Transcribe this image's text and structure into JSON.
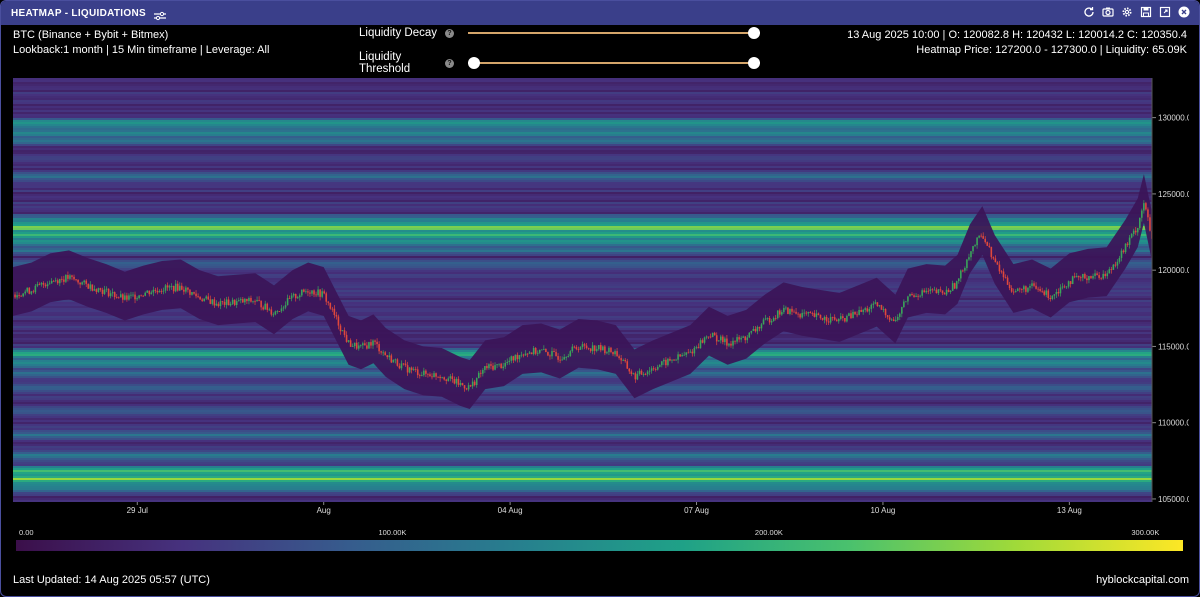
{
  "window": {
    "title": "HEATMAP - LIQUIDATIONS",
    "icons": [
      "tune-icon",
      "refresh-icon",
      "camera-icon",
      "gear-icon",
      "save-icon",
      "expand-icon",
      "close-icon"
    ]
  },
  "info": {
    "line1": "BTC (Binance + Bybit + Bitmex)",
    "line2": "Lookback:1 month | 15 Min timeframe | Leverage: All"
  },
  "ohlc": {
    "line1": "13 Aug 2025 10:00 | O: 120082.8 H: 120432 L: 120014.2 C: 120350.4",
    "line2": "Heatmap Price: 127200.0 - 127300.0 | Liquidity: 65.09K"
  },
  "controls": {
    "decay_label": "Liquidity Decay",
    "threshold_label": "Liquidity Threshold",
    "decay_value": 1.0,
    "threshold_min": 0.0,
    "threshold_max": 1.0
  },
  "footer": {
    "updated": "Last Updated: 14 Aug 2025 05:57 (UTC)",
    "brand": "hyblockcapital.com"
  },
  "colors": {
    "window_border": "#4a4f9e",
    "titlebar": "#3a3f8a",
    "up_candle": "#3aa55a",
    "down_candle": "#e0483c",
    "slider": "#d4a56a",
    "colormap": [
      "#3b0f4a",
      "#46327e",
      "#365c8d",
      "#277f8e",
      "#1fa187",
      "#4ac16d",
      "#a0da39",
      "#fde725"
    ]
  },
  "chart_data": {
    "type": "heatmap",
    "title": "",
    "y_ticks": [
      "130000.0",
      "125000.0",
      "120000.0",
      "115000.0",
      "110000.0",
      "105000.0"
    ],
    "ylim": [
      104800,
      132600
    ],
    "x_ticks": [
      {
        "label": "29 Jul",
        "t": 4
      },
      {
        "label": "Aug",
        "t": 7
      },
      {
        "label": "04 Aug",
        "t": 10
      },
      {
        "label": "07 Aug",
        "t": 13
      },
      {
        "label": "10 Aug",
        "t": 16
      },
      {
        "label": "13 Aug",
        "t": 19
      }
    ],
    "xlim": [
      2,
      20.33
    ],
    "colorbar": {
      "ticks": [
        "0.00",
        "100.00K",
        "200.00K",
        "300.00K"
      ],
      "values": [
        0,
        100000,
        200000,
        300000
      ],
      "max": 310000
    },
    "liquidity_bands": [
      {
        "price": 129600,
        "value": 185000
      },
      {
        "price": 129000,
        "value": 160000
      },
      {
        "price": 128500,
        "value": 130000
      },
      {
        "price": 127300,
        "value": 65090
      },
      {
        "price": 126100,
        "value": 120000
      },
      {
        "price": 123300,
        "value": 150000
      },
      {
        "price": 122800,
        "value": 270000
      },
      {
        "price": 122300,
        "value": 235000
      },
      {
        "price": 121900,
        "value": 175000
      },
      {
        "price": 121300,
        "value": 125000
      },
      {
        "price": 120400,
        "value": 110000
      },
      {
        "price": 114500,
        "value": 200000
      },
      {
        "price": 113900,
        "value": 175000
      },
      {
        "price": 113200,
        "value": 120000
      },
      {
        "price": 112300,
        "value": 110000
      },
      {
        "price": 110800,
        "value": 100000
      },
      {
        "price": 109200,
        "value": 120000
      },
      {
        "price": 107800,
        "value": 140000
      },
      {
        "price": 106800,
        "value": 240000
      },
      {
        "price": 106300,
        "value": 280000
      },
      {
        "price": 105800,
        "value": 160000
      }
    ],
    "price_path": [
      {
        "t": 2.0,
        "p": 118400
      },
      {
        "t": 2.3,
        "p": 118700
      },
      {
        "t": 2.6,
        "p": 119300
      },
      {
        "t": 2.9,
        "p": 119500
      },
      {
        "t": 3.2,
        "p": 119000
      },
      {
        "t": 3.5,
        "p": 118600
      },
      {
        "t": 3.8,
        "p": 118100
      },
      {
        "t": 4.1,
        "p": 118500
      },
      {
        "t": 4.4,
        "p": 118800
      },
      {
        "t": 4.7,
        "p": 118900
      },
      {
        "t": 5.0,
        "p": 118200
      },
      {
        "t": 5.3,
        "p": 117800
      },
      {
        "t": 5.6,
        "p": 117900
      },
      {
        "t": 5.9,
        "p": 118000
      },
      {
        "t": 6.2,
        "p": 117200
      },
      {
        "t": 6.5,
        "p": 118200
      },
      {
        "t": 6.75,
        "p": 118700
      },
      {
        "t": 7.0,
        "p": 118400
      },
      {
        "t": 7.2,
        "p": 116800
      },
      {
        "t": 7.4,
        "p": 115200
      },
      {
        "t": 7.6,
        "p": 114900
      },
      {
        "t": 7.8,
        "p": 115300
      },
      {
        "t": 8.0,
        "p": 114400
      },
      {
        "t": 8.3,
        "p": 113600
      },
      {
        "t": 8.6,
        "p": 113200
      },
      {
        "t": 8.9,
        "p": 113100
      },
      {
        "t": 9.2,
        "p": 112500
      },
      {
        "t": 9.35,
        "p": 112300
      },
      {
        "t": 9.6,
        "p": 113600
      },
      {
        "t": 9.9,
        "p": 113800
      },
      {
        "t": 10.2,
        "p": 114600
      },
      {
        "t": 10.5,
        "p": 114700
      },
      {
        "t": 10.8,
        "p": 114300
      },
      {
        "t": 11.1,
        "p": 115000
      },
      {
        "t": 11.4,
        "p": 114900
      },
      {
        "t": 11.7,
        "p": 114600
      },
      {
        "t": 12.0,
        "p": 113000
      },
      {
        "t": 12.3,
        "p": 113600
      },
      {
        "t": 12.6,
        "p": 114100
      },
      {
        "t": 12.9,
        "p": 114600
      },
      {
        "t": 13.2,
        "p": 115800
      },
      {
        "t": 13.5,
        "p": 115200
      },
      {
        "t": 13.8,
        "p": 115600
      },
      {
        "t": 14.1,
        "p": 116600
      },
      {
        "t": 14.4,
        "p": 117400
      },
      {
        "t": 14.7,
        "p": 117100
      },
      {
        "t": 15.0,
        "p": 116900
      },
      {
        "t": 15.3,
        "p": 116700
      },
      {
        "t": 15.6,
        "p": 117200
      },
      {
        "t": 15.9,
        "p": 117700
      },
      {
        "t": 16.2,
        "p": 116600
      },
      {
        "t": 16.4,
        "p": 118300
      },
      {
        "t": 16.7,
        "p": 118600
      },
      {
        "t": 17.0,
        "p": 118500
      },
      {
        "t": 17.2,
        "p": 119200
      },
      {
        "t": 17.4,
        "p": 121200
      },
      {
        "t": 17.6,
        "p": 122400
      },
      {
        "t": 17.8,
        "p": 120500
      },
      {
        "t": 18.1,
        "p": 118600
      },
      {
        "t": 18.4,
        "p": 118900
      },
      {
        "t": 18.7,
        "p": 118300
      },
      {
        "t": 19.0,
        "p": 119300
      },
      {
        "t": 19.3,
        "p": 119600
      },
      {
        "t": 19.6,
        "p": 119700
      },
      {
        "t": 19.9,
        "p": 121500
      },
      {
        "t": 20.1,
        "p": 122900
      },
      {
        "t": 20.2,
        "p": 124500
      },
      {
        "t": 20.33,
        "p": 122000
      }
    ]
  }
}
